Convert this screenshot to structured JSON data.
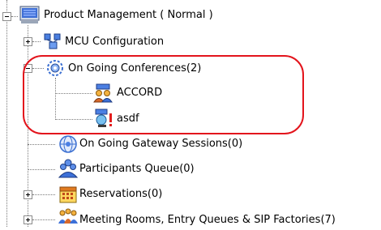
{
  "tree": {
    "root": {
      "label": "Product Management   ( Normal )",
      "icon": "monitor-icon"
    },
    "items": [
      {
        "label": "MCU Configuration",
        "icon": "network-config-icon"
      },
      {
        "label": "On Going Conferences(2)",
        "icon": "conferences-gears-icon"
      },
      {
        "label": "ACCORD",
        "icon": "conference-people-icon"
      },
      {
        "label": "asdf",
        "icon": "conference-alert-icon"
      },
      {
        "label": "On Going Gateway Sessions(0)",
        "icon": "gateway-globe-icon"
      },
      {
        "label": "Participants Queue(0)",
        "icon": "participants-queue-icon"
      },
      {
        "label": "Reservations(0)",
        "icon": "calendar-icon"
      },
      {
        "label": "Meeting Rooms, Entry Queues & SIP Factories(7)",
        "icon": "meeting-rooms-icon"
      }
    ]
  },
  "annotation": {
    "color": "#e3141c"
  }
}
